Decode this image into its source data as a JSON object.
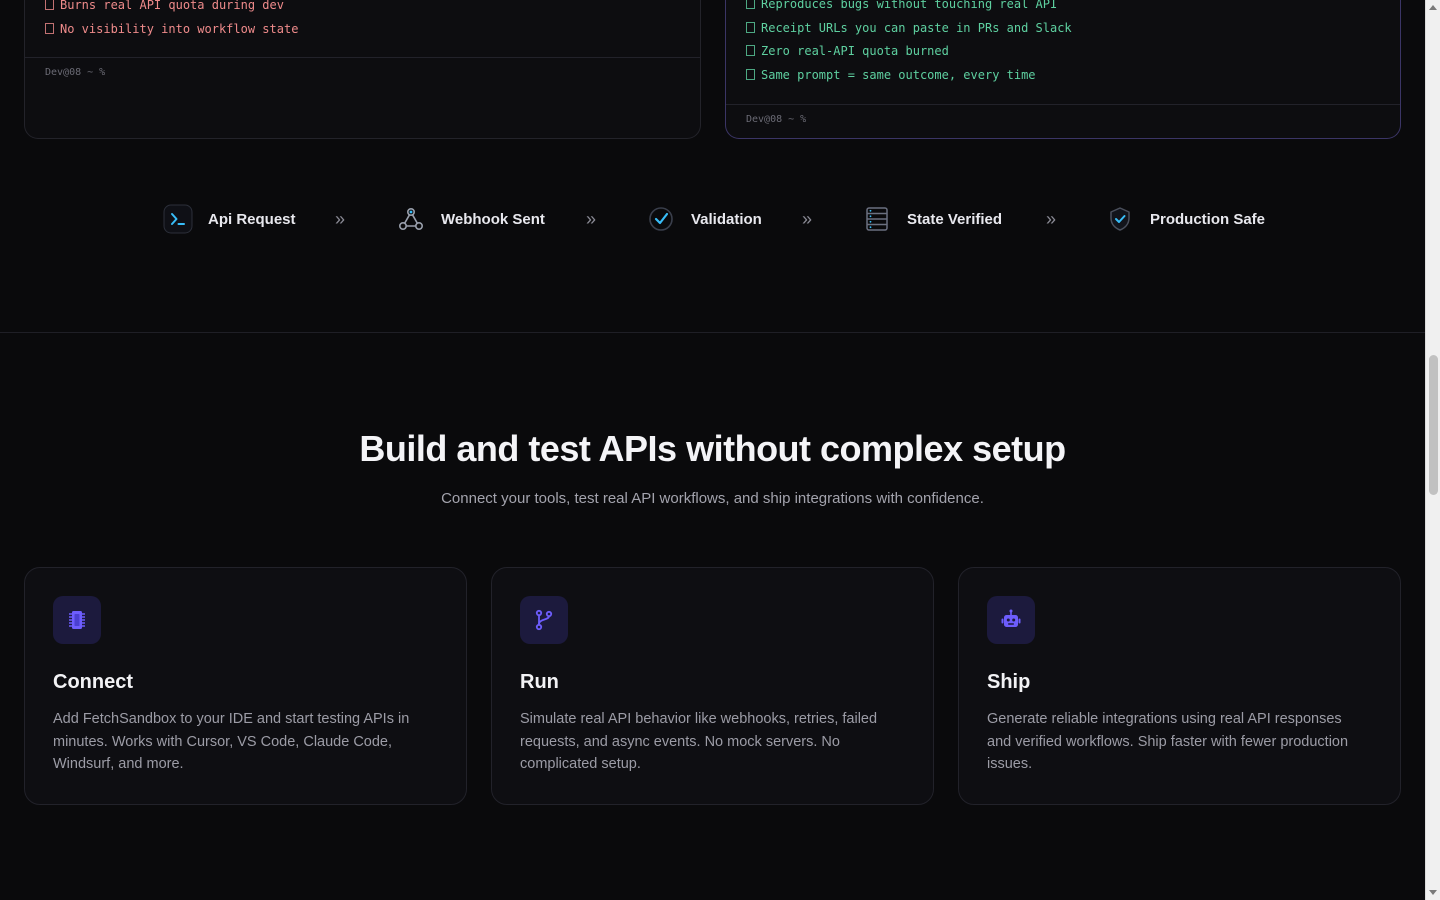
{
  "left_terminal": {
    "lines": [
      "Burns real API quota during dev",
      "No visibility into workflow state"
    ],
    "prompt": "Dev@08 ~ %"
  },
  "right_terminal": {
    "lines": [
      "Reproduces bugs without touching real API",
      "Receipt URLs you can paste in PRs and Slack",
      "Zero real-API quota burned",
      "Same prompt = same outcome, every time"
    ],
    "prompt": "Dev@08 ~ %"
  },
  "pipeline": {
    "steps": [
      {
        "label": "Api Request",
        "icon": "terminal-icon"
      },
      {
        "label": "Webhook Sent",
        "icon": "webhook-icon"
      },
      {
        "label": "Validation",
        "icon": "check-circle-icon"
      },
      {
        "label": "State Verified",
        "icon": "database-icon"
      },
      {
        "label": "Production Safe",
        "icon": "shield-check-icon"
      }
    ],
    "arrow_icon": "double-chevron-right-icon"
  },
  "section": {
    "heading": "Build and test APIs without complex setup",
    "subheading": "Connect your tools, test real API workflows, and ship integrations with confidence."
  },
  "cards": [
    {
      "title": "Connect",
      "icon": "chip-icon",
      "description": "Add FetchSandbox to your IDE and start testing APIs in minutes. Works with Cursor, VS Code, Claude Code, Windsurf, and more."
    },
    {
      "title": "Run",
      "icon": "git-branch-icon",
      "description": "Simulate real API behavior like webhooks, retries, failed requests, and async events. No mock servers. No complicated setup."
    },
    {
      "title": "Ship",
      "icon": "robot-icon",
      "description": "Generate reliable integrations using real API responses and verified workflows. Ship faster with fewer production issues."
    }
  ],
  "colors": {
    "background": "#0a0a0c",
    "accent": "#6d5dfc",
    "error_text": "#ef8b8b",
    "success_text": "#5ed0a0",
    "pipeline_icon": "#38bdf8"
  }
}
